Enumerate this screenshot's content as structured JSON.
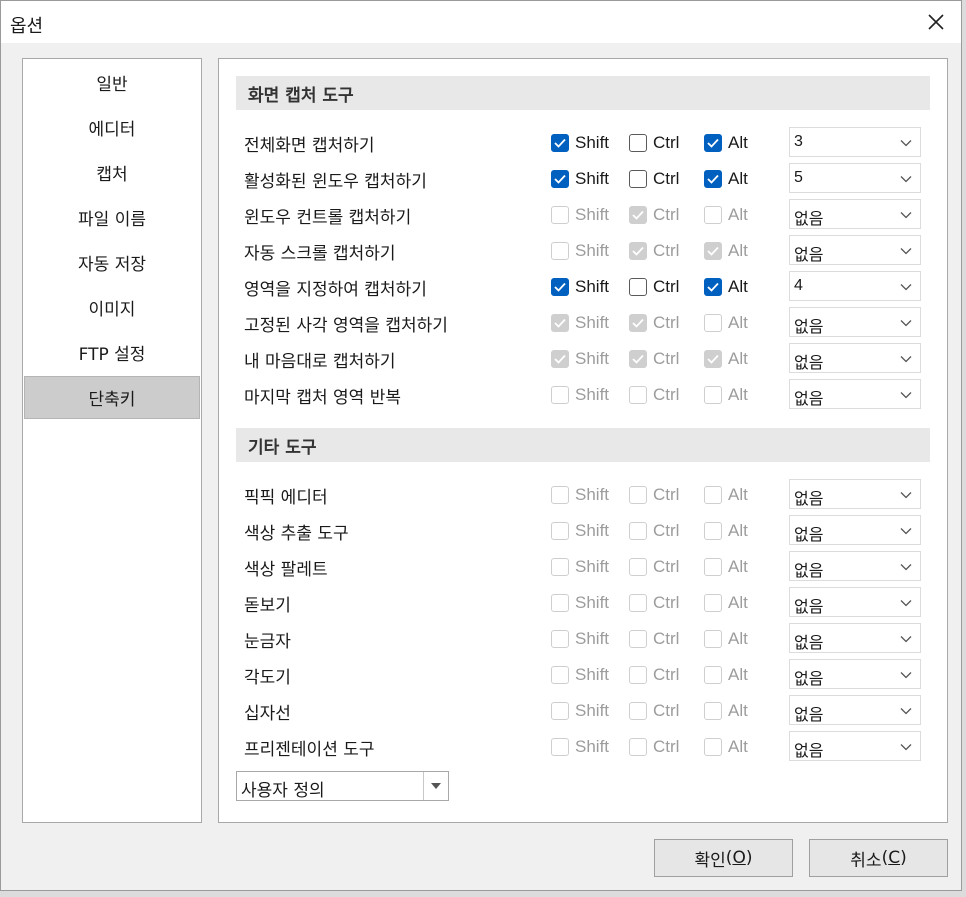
{
  "window": {
    "title": "옵션"
  },
  "nav": {
    "items": [
      {
        "label": "일반",
        "selected": false
      },
      {
        "label": "에디터",
        "selected": false
      },
      {
        "label": "캡처",
        "selected": false
      },
      {
        "label": "파일 이름",
        "selected": false
      },
      {
        "label": "자동 저장",
        "selected": false
      },
      {
        "label": "이미지",
        "selected": false
      },
      {
        "label": "FTP 설정",
        "selected": false
      },
      {
        "label": "단축키",
        "selected": true
      }
    ]
  },
  "modifier_labels": {
    "shift": "Shift",
    "ctrl": "Ctrl",
    "alt": "Alt"
  },
  "sections": [
    {
      "title": "화면 캡처 도구",
      "rows": [
        {
          "label": "전체화면 캡처하기",
          "shift": {
            "checked": true,
            "enabled": true
          },
          "ctrl": {
            "checked": false,
            "enabled": true
          },
          "alt": {
            "checked": true,
            "enabled": true
          },
          "key": "3"
        },
        {
          "label": "활성화된 윈도우 캡처하기",
          "shift": {
            "checked": true,
            "enabled": true
          },
          "ctrl": {
            "checked": false,
            "enabled": true
          },
          "alt": {
            "checked": true,
            "enabled": true
          },
          "key": "5"
        },
        {
          "label": "윈도우 컨트롤 캡처하기",
          "shift": {
            "checked": false,
            "enabled": false
          },
          "ctrl": {
            "checked": true,
            "enabled": false
          },
          "alt": {
            "checked": false,
            "enabled": false
          },
          "key": "없음"
        },
        {
          "label": "자동 스크롤 캡처하기",
          "shift": {
            "checked": false,
            "enabled": false
          },
          "ctrl": {
            "checked": true,
            "enabled": false
          },
          "alt": {
            "checked": true,
            "enabled": false
          },
          "key": "없음"
        },
        {
          "label": "영역을 지정하여 캡처하기",
          "shift": {
            "checked": true,
            "enabled": true
          },
          "ctrl": {
            "checked": false,
            "enabled": true
          },
          "alt": {
            "checked": true,
            "enabled": true
          },
          "key": "4"
        },
        {
          "label": "고정된 사각 영역을 캡처하기",
          "shift": {
            "checked": true,
            "enabled": false
          },
          "ctrl": {
            "checked": true,
            "enabled": false
          },
          "alt": {
            "checked": false,
            "enabled": false
          },
          "key": "없음"
        },
        {
          "label": "내 마음대로 캡처하기",
          "shift": {
            "checked": true,
            "enabled": false
          },
          "ctrl": {
            "checked": true,
            "enabled": false
          },
          "alt": {
            "checked": true,
            "enabled": false
          },
          "key": "없음"
        },
        {
          "label": "마지막 캡처 영역 반복",
          "shift": {
            "checked": false,
            "enabled": false
          },
          "ctrl": {
            "checked": false,
            "enabled": false
          },
          "alt": {
            "checked": false,
            "enabled": false
          },
          "key": "없음"
        }
      ]
    },
    {
      "title": "기타 도구",
      "rows": [
        {
          "label": "픽픽 에디터",
          "shift": {
            "checked": false,
            "enabled": false
          },
          "ctrl": {
            "checked": false,
            "enabled": false
          },
          "alt": {
            "checked": false,
            "enabled": false
          },
          "key": "없음"
        },
        {
          "label": "색상 추출 도구",
          "shift": {
            "checked": false,
            "enabled": false
          },
          "ctrl": {
            "checked": false,
            "enabled": false
          },
          "alt": {
            "checked": false,
            "enabled": false
          },
          "key": "없음"
        },
        {
          "label": "색상 팔레트",
          "shift": {
            "checked": false,
            "enabled": false
          },
          "ctrl": {
            "checked": false,
            "enabled": false
          },
          "alt": {
            "checked": false,
            "enabled": false
          },
          "key": "없음"
        },
        {
          "label": "돋보기",
          "shift": {
            "checked": false,
            "enabled": false
          },
          "ctrl": {
            "checked": false,
            "enabled": false
          },
          "alt": {
            "checked": false,
            "enabled": false
          },
          "key": "없음"
        },
        {
          "label": "눈금자",
          "shift": {
            "checked": false,
            "enabled": false
          },
          "ctrl": {
            "checked": false,
            "enabled": false
          },
          "alt": {
            "checked": false,
            "enabled": false
          },
          "key": "없음"
        },
        {
          "label": "각도기",
          "shift": {
            "checked": false,
            "enabled": false
          },
          "ctrl": {
            "checked": false,
            "enabled": false
          },
          "alt": {
            "checked": false,
            "enabled": false
          },
          "key": "없음"
        },
        {
          "label": "십자선",
          "shift": {
            "checked": false,
            "enabled": false
          },
          "ctrl": {
            "checked": false,
            "enabled": false
          },
          "alt": {
            "checked": false,
            "enabled": false
          },
          "key": "없음"
        },
        {
          "label": "프리젠테이션 도구",
          "shift": {
            "checked": false,
            "enabled": false
          },
          "ctrl": {
            "checked": false,
            "enabled": false
          },
          "alt": {
            "checked": false,
            "enabled": false
          },
          "key": "없음"
        }
      ]
    }
  ],
  "preset": {
    "value": "사용자 정의"
  },
  "buttons": {
    "ok": {
      "label": "확인",
      "mnemonic": "O"
    },
    "cancel": {
      "label": "취소",
      "mnemonic": "C"
    }
  },
  "colors": {
    "accent": "#0060c0",
    "selected_nav": "#cccccc",
    "section_header": "#e8e8e8"
  }
}
